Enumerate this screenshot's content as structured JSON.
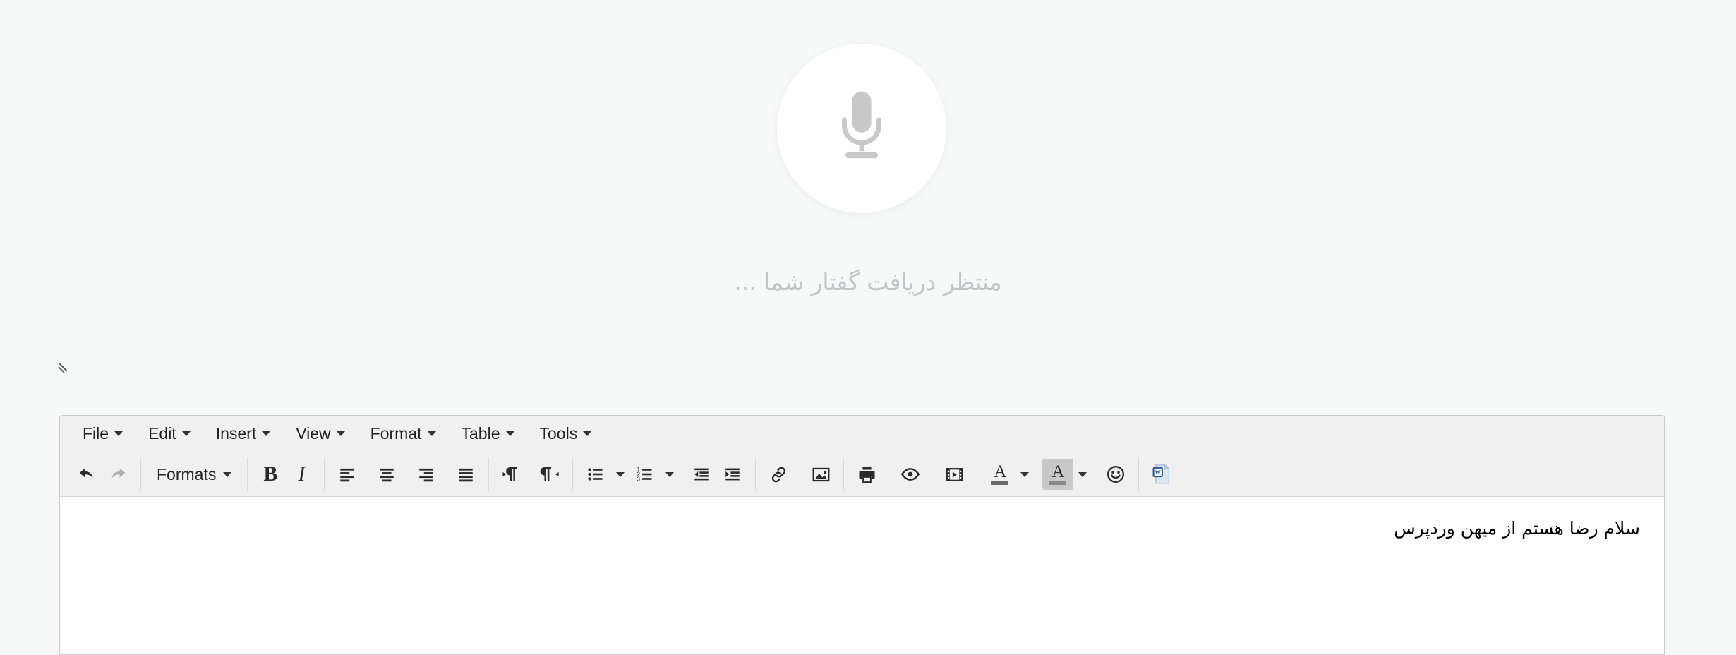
{
  "colors": {
    "page_background": "#f7f8f8",
    "chrome_background": "#f0f0f0",
    "editor_border": "#cccccc",
    "content_background": "#ffffff",
    "icon_dark": "#2b2b2b",
    "icon_disabled": "#aaaaaa",
    "status_text": "#c3c4c5",
    "word_icon_blue": "#2b5797"
  },
  "voice": {
    "mic_icon": "microphone-icon",
    "status_text": "منتظر دریافت گفتار شما ..."
  },
  "editor": {
    "menubar": [
      {
        "label": "File",
        "caret": "chevron-down-icon"
      },
      {
        "label": "Edit",
        "caret": "chevron-down-icon"
      },
      {
        "label": "Insert",
        "caret": "chevron-down-icon"
      },
      {
        "label": "View",
        "caret": "chevron-down-icon"
      },
      {
        "label": "Format",
        "caret": "chevron-down-icon"
      },
      {
        "label": "Table",
        "caret": "chevron-down-icon"
      },
      {
        "label": "Tools",
        "caret": "chevron-down-icon"
      }
    ],
    "toolbar": {
      "undo": {
        "name": "undo-icon",
        "title": "Undo",
        "state": "enabled"
      },
      "redo": {
        "name": "redo-icon",
        "title": "Redo",
        "state": "disabled"
      },
      "formats": {
        "label": "Formats",
        "caret": "chevron-down-icon"
      },
      "bold": {
        "label": "B",
        "title": "Bold"
      },
      "italic": {
        "label": "I",
        "title": "Italic"
      },
      "align_left": {
        "name": "align-left-icon",
        "title": "Align left"
      },
      "align_center": {
        "name": "align-center-icon",
        "title": "Align center"
      },
      "align_right": {
        "name": "align-right-icon",
        "title": "Align right"
      },
      "align_justify": {
        "name": "align-justify-icon",
        "title": "Justify"
      },
      "ltr": {
        "name": "ltr-icon",
        "title": "Left to right"
      },
      "rtl": {
        "name": "rtl-icon",
        "title": "Right to left"
      },
      "bullist": {
        "name": "bullet-list-icon",
        "title": "Bullet list"
      },
      "numlist": {
        "name": "numbered-list-icon",
        "title": "Numbered list"
      },
      "outdent": {
        "name": "outdent-icon",
        "title": "Decrease indent"
      },
      "indent": {
        "name": "indent-icon",
        "title": "Increase indent"
      },
      "link": {
        "name": "link-icon",
        "title": "Insert/edit link"
      },
      "image": {
        "name": "image-icon",
        "title": "Insert/edit image"
      },
      "print": {
        "name": "print-icon",
        "title": "Print"
      },
      "preview": {
        "name": "preview-eye-icon",
        "title": "Preview"
      },
      "media": {
        "name": "media-film-icon",
        "title": "Insert/edit media"
      },
      "forecolor": {
        "label": "A",
        "name": "text-color-icon",
        "title": "Text color"
      },
      "backcolor": {
        "label": "A",
        "name": "background-color-icon",
        "title": "Background color"
      },
      "emoticons": {
        "name": "smiley-icon",
        "title": "Emoticons"
      },
      "word_paste": {
        "name": "word-document-icon",
        "title": "Paste from Word"
      }
    },
    "content": {
      "body_text": "سلام رضا هستم از میهن وردپرس"
    }
  }
}
